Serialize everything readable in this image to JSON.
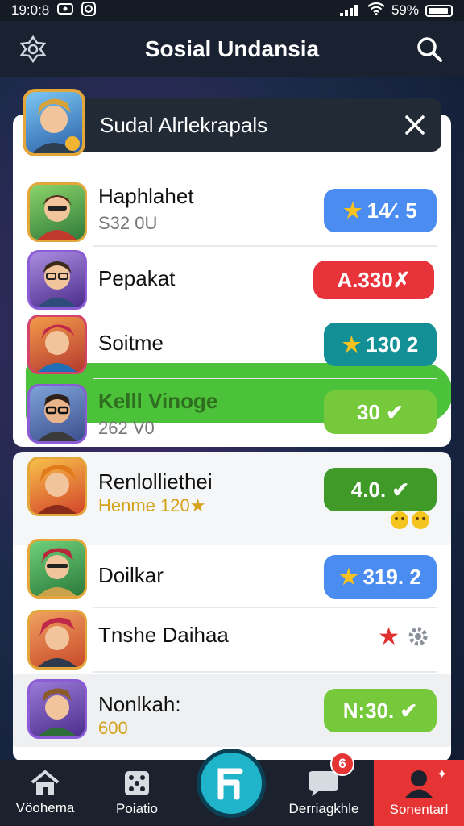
{
  "status_bar": {
    "time": "19:0:8",
    "battery": "59%"
  },
  "header": {
    "title": "Sosial Undansia"
  },
  "popup": {
    "title": "Sudal Alrlekrapals"
  },
  "list": [
    {
      "name": "Haphlahet",
      "sub": "S32 0U",
      "score": "14⁄. 5",
      "pill_color": "#4b8cf0",
      "star": true
    },
    {
      "name": "Pepakat",
      "sub": "",
      "score": "A.330✗",
      "pill_color": "#e8333a",
      "star": false,
      "highlight": true
    },
    {
      "name": "Soitme",
      "sub": "",
      "score": "130 2",
      "pill_color": "#138f96",
      "star": true
    },
    {
      "name": "Kelll Vinoge",
      "sub": "262 V0",
      "score": "30 ✔",
      "pill_color": "#76c93a",
      "star": false
    }
  ],
  "list2": [
    {
      "name": "Renlolliethei",
      "sub": "Henme 120★",
      "score": "4.0. ✔",
      "pill_color": "#3f9a28",
      "star": false
    },
    {
      "name": "Doilkar",
      "sub": "",
      "score": "319. 2",
      "pill_color": "#4b8cf0",
      "star": true
    },
    {
      "name": "Tnshe Daihaa",
      "sub": "",
      "score": "",
      "pill_color": "",
      "star": false
    },
    {
      "name": "Nonlkah:",
      "sub": "600",
      "score": "N:30. ✔",
      "pill_color": "#76c93a",
      "star": false
    }
  ],
  "bottom_nav": [
    {
      "label": "Vöohema",
      "icon": "home-icon"
    },
    {
      "label": "Poiatio",
      "icon": "dice-icon"
    },
    {
      "label": "",
      "icon": "fab-icon"
    },
    {
      "label": "Derriagkhle",
      "icon": "chat-icon",
      "badge": "6"
    },
    {
      "label": "Sonentarl",
      "icon": "profile-icon"
    }
  ],
  "colors": {
    "accent_green": "#4cc23a",
    "danger": "#e8333a",
    "fab": "#1fb4c9"
  }
}
